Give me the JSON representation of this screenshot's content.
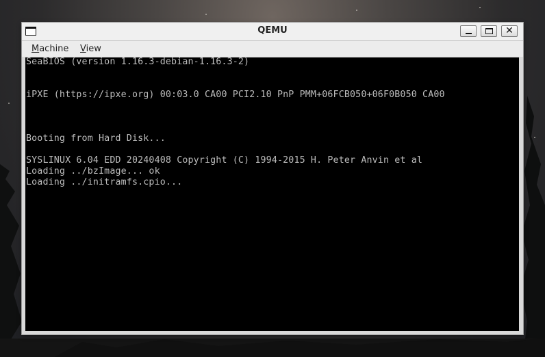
{
  "window": {
    "title": "QEMU",
    "app_icon": "window-icon",
    "controls": {
      "minimize": "minimize-icon",
      "maximize": "maximize-icon",
      "close_label": "✕"
    }
  },
  "menubar": {
    "items": [
      {
        "mnemonic": "M",
        "rest": "achine"
      },
      {
        "mnemonic": "V",
        "rest": "iew"
      }
    ]
  },
  "console": {
    "lines": [
      "SeaBIOS (version 1.16.3-debian-1.16.3-2)",
      "",
      "",
      "iPXE (https://ipxe.org) 00:03.0 CA00 PCI2.10 PnP PMM+06FCB050+06F0B050 CA00",
      "",
      "",
      "",
      "Booting from Hard Disk...",
      "",
      "SYSLINUX 6.04 EDD 20240408 Copyright (C) 1994-2015 H. Peter Anvin et al",
      "Loading ../bzImage... ok",
      "Loading ../initramfs.cpio..."
    ]
  },
  "colors": {
    "console_text": "#bdbdbd",
    "console_bg": "#000000",
    "window_frame": "#d9d9d9"
  }
}
